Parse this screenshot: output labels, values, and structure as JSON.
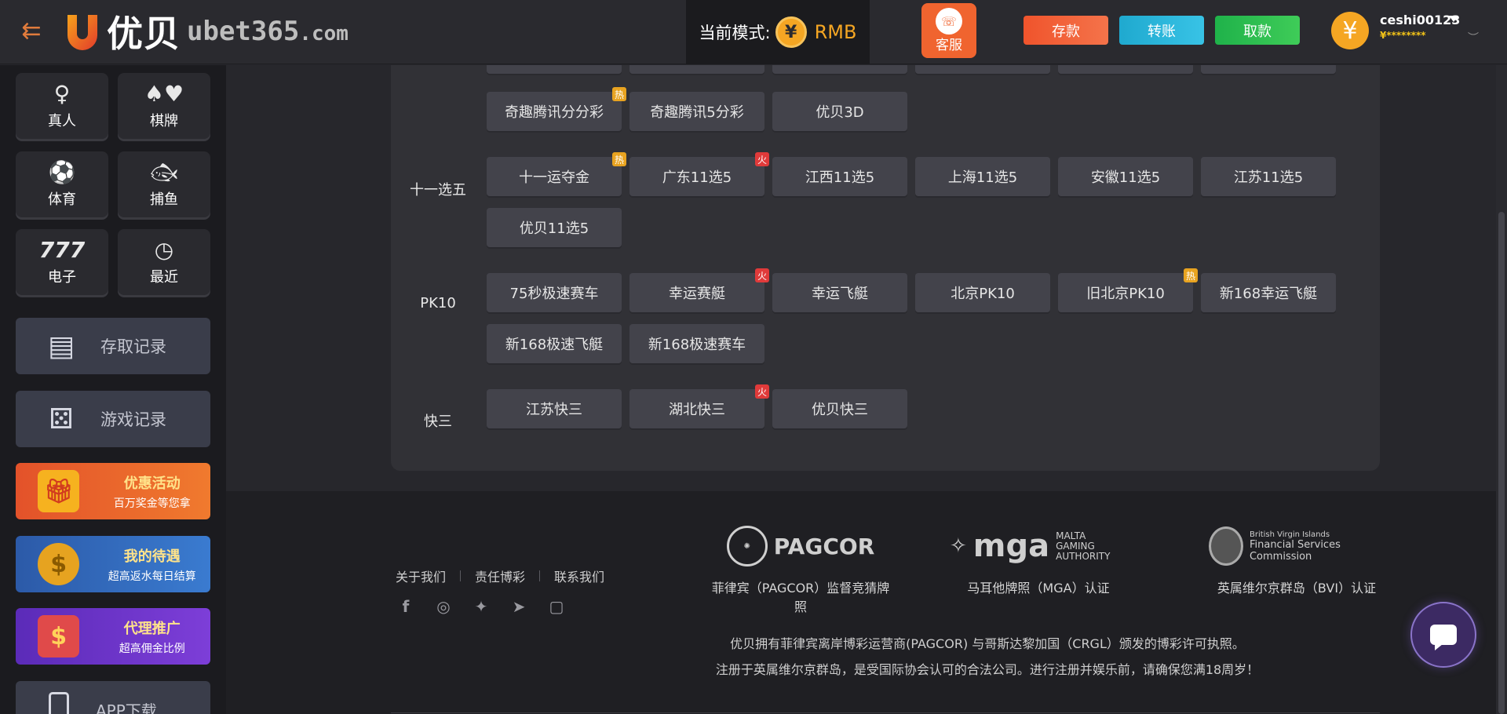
{
  "header": {
    "logo_cn": "优贝",
    "logo_domain": "ubet365",
    "logo_tld": ".com",
    "mode_label": "当前模式:",
    "mode_value": "RMB",
    "service_label": "客服",
    "deposit_label": "存款",
    "transfer_label": "转账",
    "withdraw_label": "取款",
    "username": "ceshi00123",
    "balance": "¥********"
  },
  "sidebar": {
    "tiles": [
      {
        "label": "真人",
        "icon": "live-dealer-icon"
      },
      {
        "label": "棋牌",
        "icon": "cards-icon"
      },
      {
        "label": "体育",
        "icon": "soccer-ball-icon"
      },
      {
        "label": "捕鱼",
        "icon": "fish-icon"
      },
      {
        "label": "电子",
        "icon": "slot-777-icon"
      },
      {
        "label": "最近",
        "icon": "clock-icon"
      }
    ],
    "menu": [
      {
        "label": "存取记录",
        "icon": "coins-record-icon"
      },
      {
        "label": "游戏记录",
        "icon": "dice-icon"
      }
    ],
    "promos": [
      {
        "title": "优惠活动",
        "subtitle": "百万奖金等您拿",
        "icon": "gift-icon"
      },
      {
        "title": "我的待遇",
        "subtitle": "超高返水每日结算",
        "icon": "gold-coin-icon"
      },
      {
        "title": "代理推广",
        "subtitle": "超高佣金比例",
        "icon": "wallet-icon"
      }
    ],
    "app_label": "APP下载"
  },
  "games": {
    "partial_row": [
      "",
      "",
      "",
      "",
      "",
      ""
    ],
    "lottery_row2": [
      {
        "name": "奇趣腾讯分分彩",
        "tag": "热"
      },
      {
        "name": "奇趣腾讯5分彩",
        "tag": ""
      },
      {
        "name": "优贝3D",
        "tag": ""
      }
    ],
    "categories": [
      {
        "label": "十一选五",
        "rows": [
          [
            {
              "name": "十一运夺金",
              "tag": "热"
            },
            {
              "name": "广东11选5",
              "tag": "火"
            },
            {
              "name": "江西11选5",
              "tag": ""
            },
            {
              "name": "上海11选5",
              "tag": ""
            },
            {
              "name": "安徽11选5",
              "tag": ""
            },
            {
              "name": "江苏11选5",
              "tag": ""
            }
          ],
          [
            {
              "name": "优贝11选5",
              "tag": ""
            }
          ]
        ]
      },
      {
        "label": "PK10",
        "rows": [
          [
            {
              "name": "75秒极速赛车",
              "tag": ""
            },
            {
              "name": "幸运赛艇",
              "tag": "火"
            },
            {
              "name": "幸运飞艇",
              "tag": ""
            },
            {
              "name": "北京PK10",
              "tag": ""
            },
            {
              "name": "旧北京PK10",
              "tag": "热"
            },
            {
              "name": "新168幸运飞艇",
              "tag": ""
            }
          ],
          [
            {
              "name": "新168极速飞艇",
              "tag": ""
            },
            {
              "name": "新168极速赛车",
              "tag": ""
            }
          ]
        ]
      },
      {
        "label": "快三",
        "rows": [
          [
            {
              "name": "江苏快三",
              "tag": ""
            },
            {
              "name": "湖北快三",
              "tag": "火"
            },
            {
              "name": "优贝快三",
              "tag": ""
            }
          ]
        ]
      }
    ]
  },
  "footer": {
    "links": [
      "关于我们",
      "责任博彩",
      "联系我们"
    ],
    "social_icons": [
      "facebook-icon",
      "instagram-icon",
      "twitter-icon",
      "telegram-icon",
      "line-icon"
    ],
    "licenses": [
      {
        "name": "PAGCOR",
        "caption": "菲律宾（PAGCOR）监督竞猜牌照"
      },
      {
        "name": "mga",
        "sub1": "MALTA GAMING",
        "sub2": "AUTHORITY",
        "caption": "马耳他牌照（MGA）认证"
      },
      {
        "name_line1": "British Virgin Islands",
        "name_line2": "Financial Services Commission",
        "caption": "英属维尔京群岛（BVI）认证"
      }
    ],
    "disclaimer_line1": "优贝拥有菲律宾离岸博彩运营商(PAGCOR) 与哥斯达黎加国（CRGL）颁发的博彩许可执照。",
    "disclaimer_line2": "注册于英属维尔京群岛，是受国际协会认可的合法公司。进行注册并娱乐前，请确保您满18周岁！"
  },
  "colors": {
    "accent_orange": "#f0642f",
    "coin_gold": "#f5a623",
    "tag_hot": "#e8a320",
    "tag_fire": "#e03a3a"
  }
}
